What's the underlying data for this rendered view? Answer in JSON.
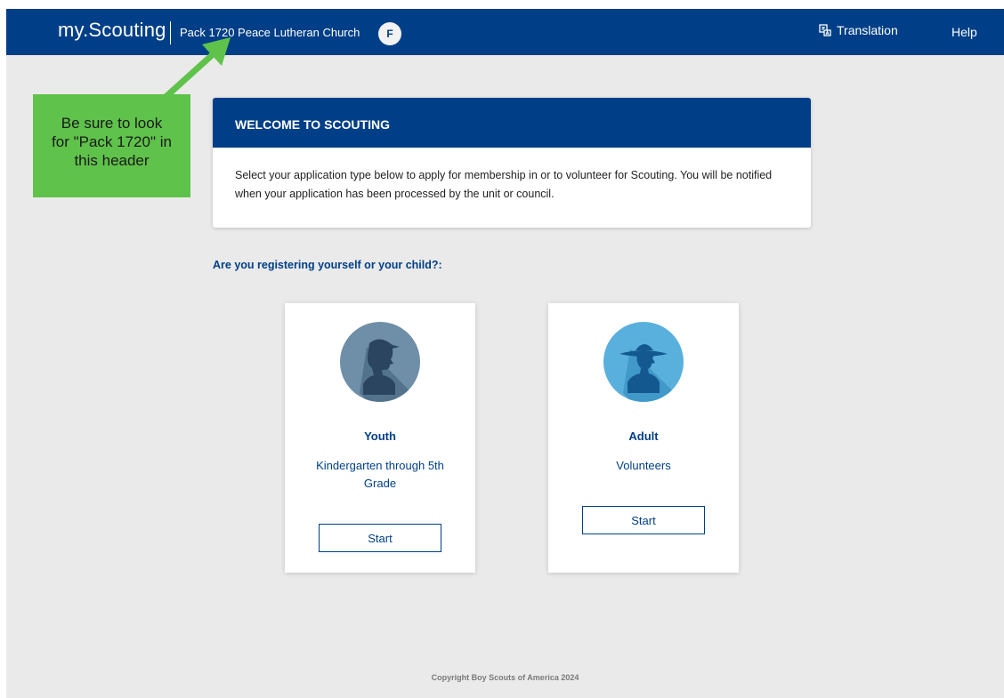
{
  "header": {
    "brand": "my.Scouting",
    "unit_name": "Pack 1720 Peace Lutheran Church",
    "avatar_initial": "F",
    "translation_label": "Translation",
    "help_label": "Help"
  },
  "callout": {
    "lines": [
      "Be sure to look",
      "for \"Pack 1720\" in",
      "this header"
    ]
  },
  "welcome": {
    "title": "WELCOME TO SCOUTING",
    "body": "Select your application type below to apply for membership in or to volunteer for Scouting. You will be notified when your application has been processed by the unit or council."
  },
  "question": "Are you registering yourself or your child?:",
  "options": [
    {
      "title": "Youth",
      "description": "Kindergarten through 5th Grade",
      "button": "Start"
    },
    {
      "title": "Adult",
      "description": "Volunteers",
      "button": "Start"
    }
  ],
  "footer": {
    "copyright": "Copyright Boy Scouts of America 2024"
  },
  "colors": {
    "brand_blue": "#003f87",
    "callout_green": "#5fc24a",
    "page_bg": "#eaeaea",
    "youth_icon": "#6f8fa8",
    "adult_icon": "#5ab0dc"
  },
  "icons": {
    "translation": "translate-icon",
    "youth": "youth-scout-silhouette-icon",
    "adult": "adult-scout-silhouette-icon",
    "arrow": "callout-arrow-icon"
  }
}
